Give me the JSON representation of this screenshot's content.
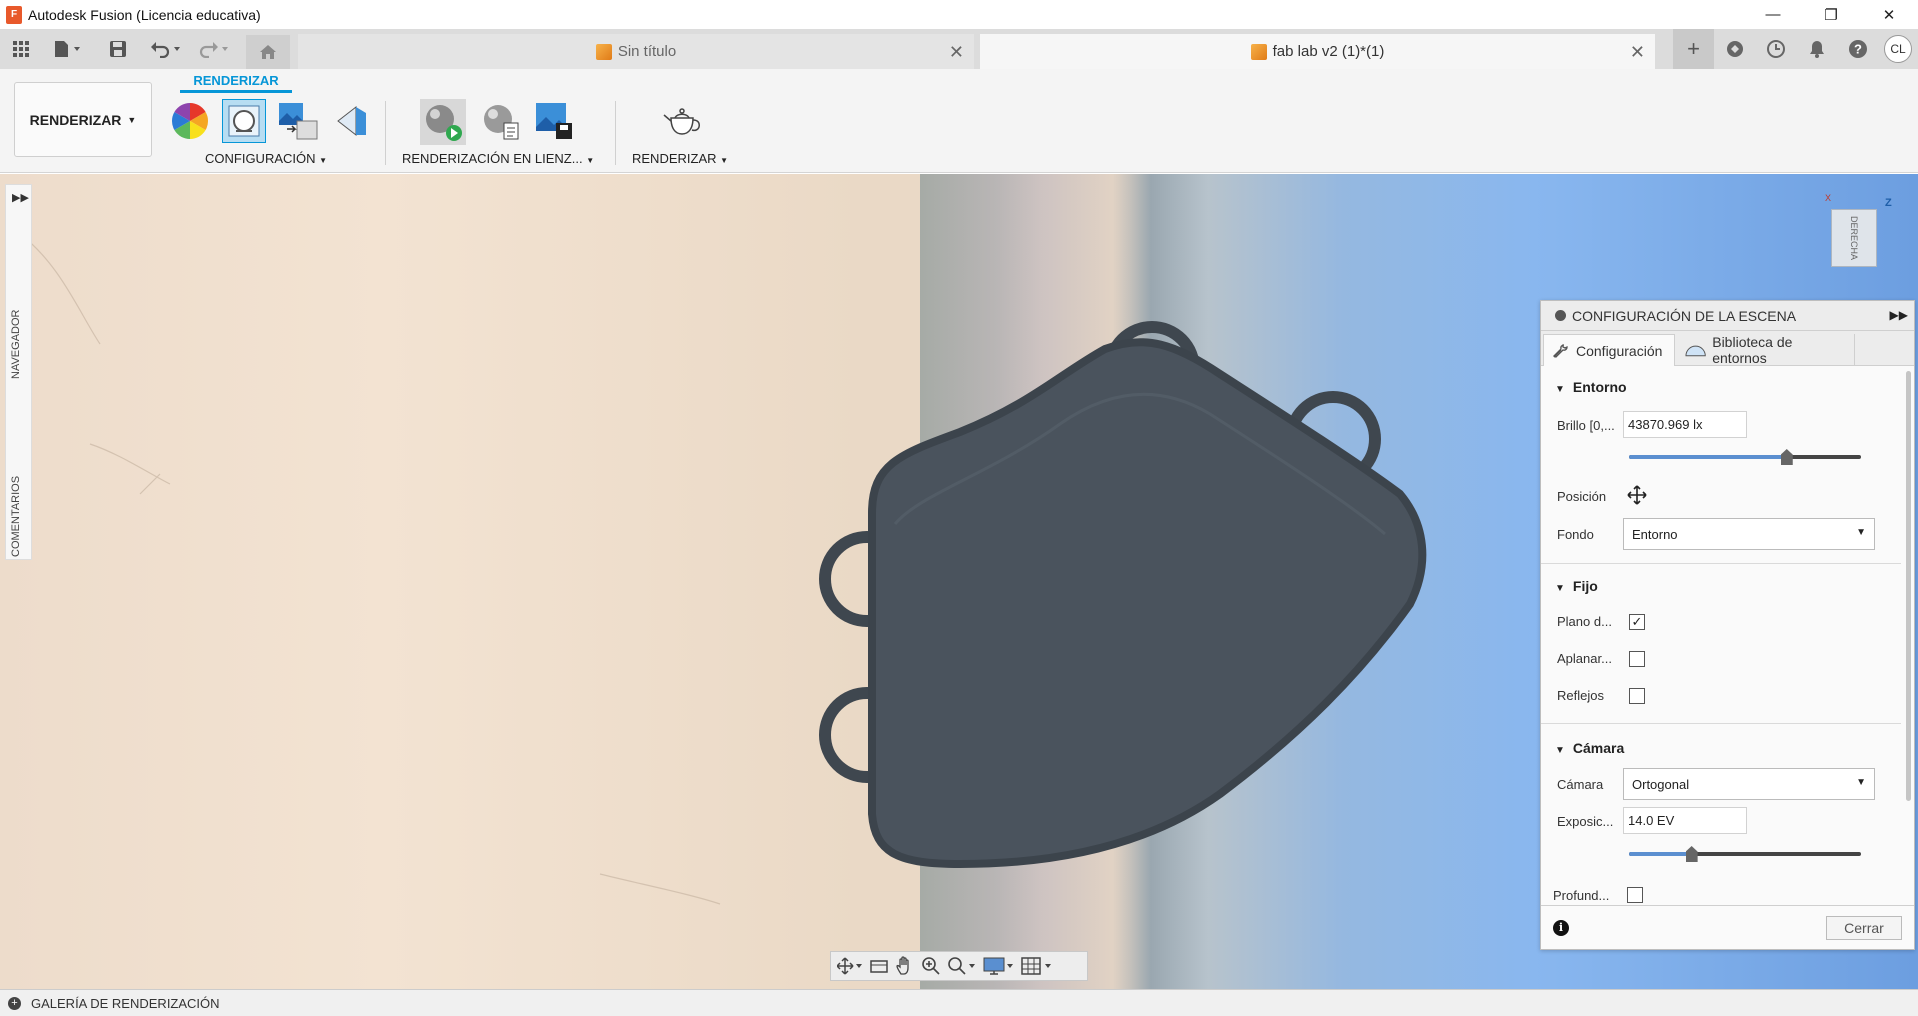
{
  "window": {
    "title": "Autodesk Fusion (Licencia educativa)",
    "logo_letter": "F",
    "minimize": "—",
    "maximize": "❐",
    "close": "✕"
  },
  "tabs": [
    {
      "label": "Sin título",
      "active": false
    },
    {
      "label": "fab lab v2 (1)*(1)",
      "active": true
    }
  ],
  "user": {
    "initials": "CL"
  },
  "toolbar": {
    "workspace": "RENDERIZAR",
    "active_tab": "RENDERIZAR",
    "groups": [
      {
        "label": "CONFIGURACIÓN"
      },
      {
        "label": "RENDERIZACIÓN EN LIENZ..."
      },
      {
        "label": "RENDERIZAR"
      }
    ]
  },
  "left_strip": {
    "navigator": "NAVEGADOR",
    "comments": "COMENTARIOS"
  },
  "viewcube": {
    "face": "DERECHA",
    "z_axis": "Z",
    "x_axis": "X"
  },
  "scene_panel": {
    "title": "CONFIGURACIÓN DE LA ESCENA",
    "tabs": {
      "config": "Configuración",
      "library": "Biblioteca de entornos"
    },
    "entorno": {
      "title": "Entorno",
      "brightness_label": "Brillo [0,...",
      "brightness_value": "43870.969 lx",
      "brightness_slider": 0.68,
      "position_label": "Posición",
      "background_label": "Fondo",
      "background_value": "Entorno"
    },
    "fijo": {
      "title": "Fijo",
      "ground_label": "Plano d...",
      "ground_checked": true,
      "flatten_label": "Aplanar...",
      "flatten_checked": false,
      "reflections_label": "Reflejos",
      "reflections_checked": false
    },
    "camara": {
      "title": "Cámara",
      "camera_label": "Cámara",
      "camera_value": "Ortogonal",
      "exposure_label": "Exposic...",
      "exposure_value": "14.0 EV",
      "exposure_slider": 0.27,
      "depth_label": "Profund...",
      "depth_checked": false
    },
    "close_label": "Cerrar"
  },
  "bottom": {
    "gallery_label": "GALERÍA DE RENDERIZACIÓN"
  },
  "colors": {
    "accent": "#0696d7",
    "model": "#4a535d"
  }
}
